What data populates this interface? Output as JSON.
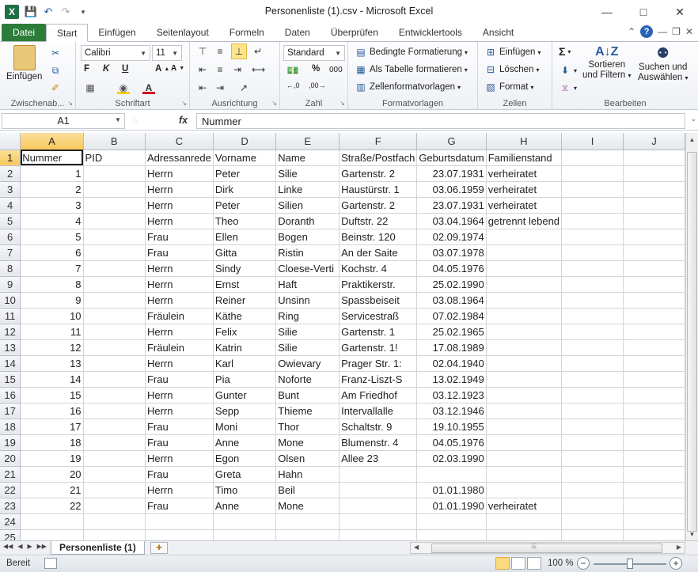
{
  "window": {
    "title": "Personenliste (1).csv - Microsoft Excel",
    "app_icon": "X"
  },
  "ribbon_tabs": [
    "Datei",
    "Start",
    "Einfügen",
    "Seitenlayout",
    "Formeln",
    "Daten",
    "Überprüfen",
    "Entwicklertools",
    "Ansicht"
  ],
  "ribbon": {
    "clipboard": {
      "label": "Zwischenab...",
      "paste": "Einfügen"
    },
    "font": {
      "label": "Schriftart",
      "name": "Calibri",
      "size": "11",
      "bold": "F",
      "italic": "K",
      "underline": "U"
    },
    "alignment": {
      "label": "Ausrichtung"
    },
    "number": {
      "label": "Zahl",
      "format": "Standard",
      "percent": "%",
      "thousands": "000"
    },
    "styles": {
      "label": "Formatvorlagen",
      "conditional": "Bedingte Formatierung",
      "as_table": "Als Tabelle formatieren",
      "cell_styles": "Zellenformatvorlagen"
    },
    "cells": {
      "label": "Zellen",
      "insert": "Einfügen",
      "delete": "Löschen",
      "format": "Format"
    },
    "editing": {
      "label": "Bearbeiten",
      "sigma": "Σ",
      "sort_line1": "Sortieren",
      "sort_line2": "und Filtern",
      "find_line1": "Suchen und",
      "find_line2": "Auswählen"
    }
  },
  "formula_bar": {
    "name_box": "A1",
    "fx": "fx",
    "content": "Nummer"
  },
  "columns": [
    "A",
    "B",
    "C",
    "D",
    "E",
    "F",
    "G",
    "H",
    "I",
    "J"
  ],
  "rows": [
    [
      "Nummer",
      "PID",
      "Adressanrede",
      "Vorname",
      "Name",
      "Straße/Postfach",
      "Geburtsdatum",
      "Familienstand",
      "",
      ""
    ],
    [
      "1",
      "",
      "Herrn",
      "Peter",
      "Silie",
      "Gartenstr. 2",
      "23.07.1931",
      "verheiratet",
      "",
      ""
    ],
    [
      "2",
      "",
      "Herrn",
      "Dirk",
      "Linke",
      "Haustürstr. 1",
      "03.06.1959",
      "verheiratet",
      "",
      ""
    ],
    [
      "3",
      "",
      "Herrn",
      "Peter",
      "Silien",
      "Gartenstr.  2",
      "23.07.1931",
      "verheiratet",
      "",
      ""
    ],
    [
      "4",
      "",
      "Herrn",
      "Theo",
      "Doranth",
      "Duftstr. 22",
      "03.04.1964",
      "getrennt lebend",
      "",
      ""
    ],
    [
      "5",
      "",
      "Frau",
      "Ellen",
      "Bogen",
      "Beinstr. 120",
      "02.09.1974",
      "",
      "",
      ""
    ],
    [
      "6",
      "",
      "Frau",
      "Gitta",
      "Ristin",
      "An der Saite",
      "03.07.1978",
      "",
      "",
      ""
    ],
    [
      "7",
      "",
      "Herrn",
      "Sindy",
      "Cloese-Verti",
      "Kochstr. 4",
      "04.05.1976",
      "",
      "",
      ""
    ],
    [
      "8",
      "",
      "Herrn",
      "Ernst",
      "Haft",
      "Praktikerstr.",
      "25.02.1990",
      "",
      "",
      ""
    ],
    [
      "9",
      "",
      "Herrn",
      "Reiner",
      "Unsinn",
      "Spassbeiseit",
      "03.08.1964",
      "",
      "",
      ""
    ],
    [
      "10",
      "",
      "Fräulein",
      "Käthe",
      "Ring",
      "Servicestraß",
      "07.02.1984",
      "",
      "",
      ""
    ],
    [
      "11",
      "",
      "Herrn",
      "Felix",
      "Silie",
      "Gartenstr.  1",
      "25.02.1965",
      "",
      "",
      ""
    ],
    [
      "12",
      "",
      "Fräulein",
      "Katrin",
      "Silie",
      "Gartenstr.  1!",
      "17.08.1989",
      "",
      "",
      ""
    ],
    [
      "13",
      "",
      "Herrn",
      "Karl",
      "Owievary",
      "Prager Str. 1:",
      "02.04.1940",
      "",
      "",
      ""
    ],
    [
      "14",
      "",
      "Frau",
      "Pia",
      "Noforte",
      "Franz-Liszt-S",
      "13.02.1949",
      "",
      "",
      ""
    ],
    [
      "15",
      "",
      "Herrn",
      "Gunter",
      "Bunt",
      "Am Friedhof",
      "03.12.1923",
      "",
      "",
      ""
    ],
    [
      "16",
      "",
      "Herrn",
      "Sepp",
      "Thieme",
      "Intervallalle",
      "03.12.1946",
      "",
      "",
      ""
    ],
    [
      "17",
      "",
      "Frau",
      "Moni",
      "Thor",
      "Schaltstr. 9",
      "19.10.1955",
      "",
      "",
      ""
    ],
    [
      "18",
      "",
      "Frau",
      "Anne",
      "Mone",
      "Blumenstr. 4",
      "04.05.1976",
      "",
      "",
      ""
    ],
    [
      "19",
      "",
      "Herrn",
      "Egon",
      "Olsen",
      "Allee 23",
      "02.03.1990",
      "",
      "",
      ""
    ],
    [
      "20",
      "",
      "Frau",
      "Greta",
      "Hahn",
      "",
      "",
      "",
      "",
      ""
    ],
    [
      "21",
      "",
      "Herrn",
      "Timo",
      "Beil",
      "",
      "01.01.1980",
      "",
      "",
      ""
    ],
    [
      "22",
      "",
      "Frau",
      "Anne",
      "Mone",
      "",
      "01.01.1990",
      "verheiratet",
      "",
      ""
    ],
    [
      "",
      "",
      "",
      "",
      "",
      "",
      "",
      "",
      "",
      ""
    ],
    [
      "",
      "",
      "",
      "",
      "",
      "",
      "",
      "",
      "",
      ""
    ],
    [
      "",
      "",
      "",
      "",
      "",
      "",
      "",
      "",
      "",
      ""
    ]
  ],
  "sheet_tab": "Personenliste (1)",
  "status": {
    "ready": "Bereit",
    "zoom": "100 %"
  }
}
